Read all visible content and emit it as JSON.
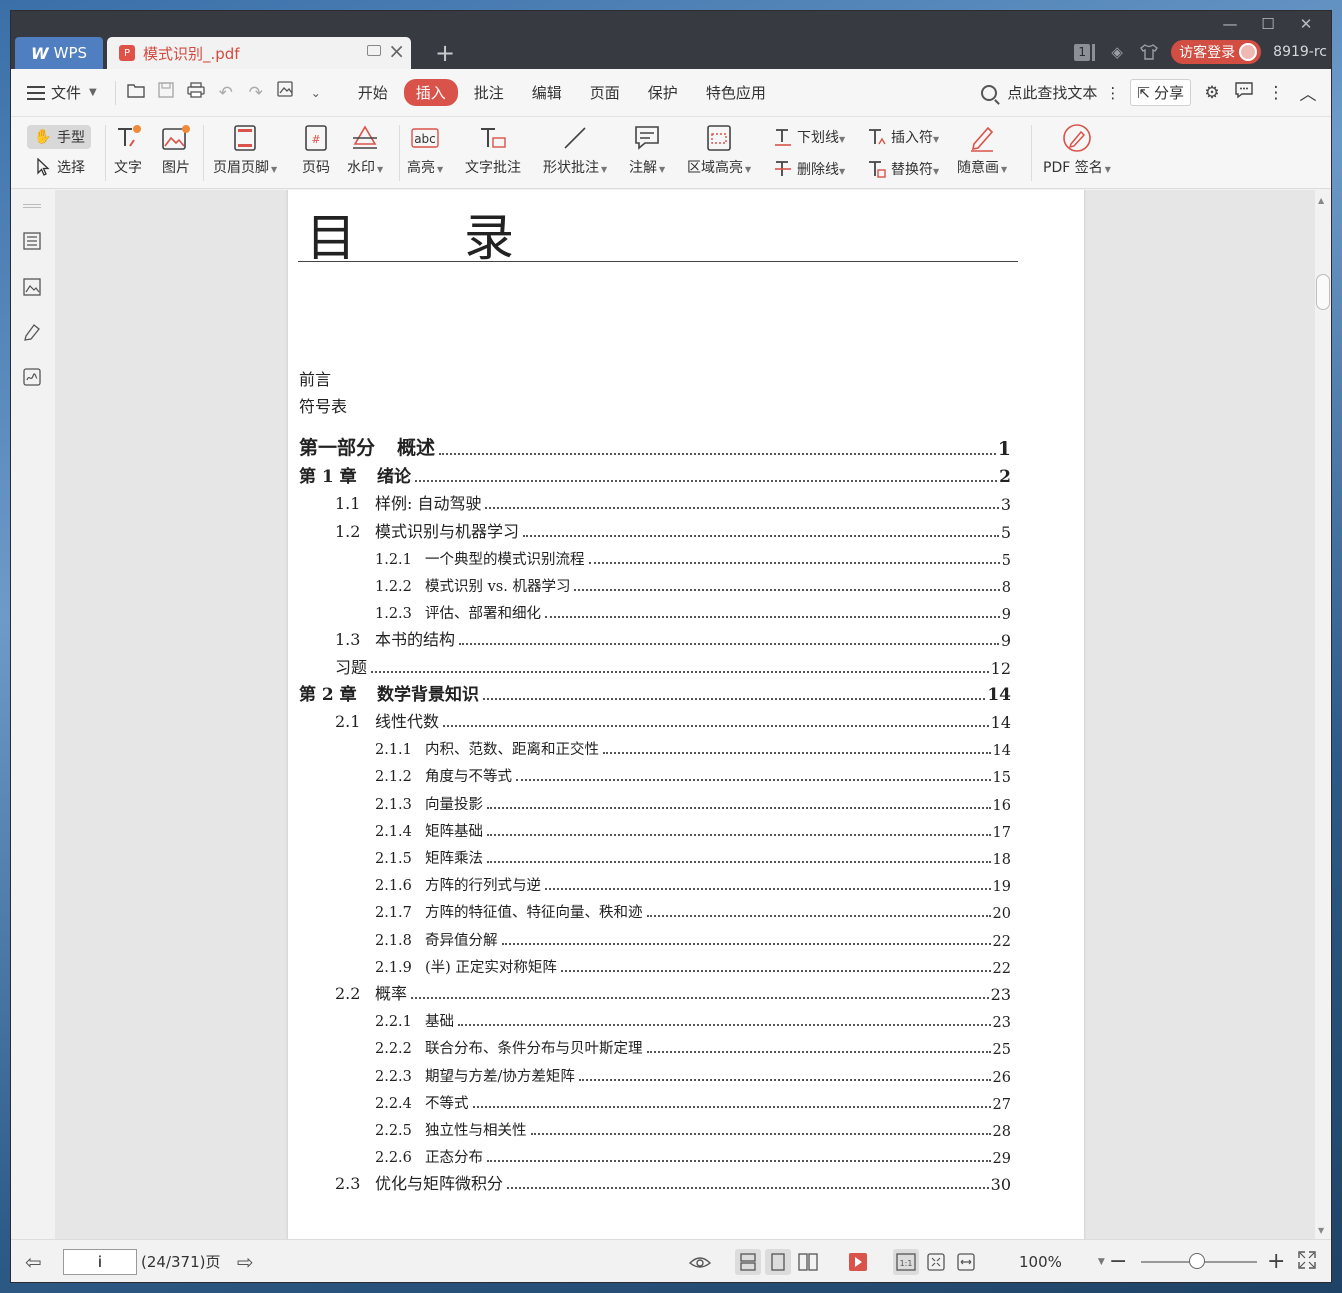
{
  "titlebar": {
    "wps_label": "WPS",
    "doc_tab_title": "模式识别_.pdf",
    "new_tab": "+",
    "tab_count": "1",
    "login_label": "访客登录",
    "user_name": "8919-rc"
  },
  "menubar": {
    "file_label": "文件",
    "tabs": [
      "开始",
      "插入",
      "批注",
      "编辑",
      "页面",
      "保护",
      "特色应用"
    ],
    "active_tab": "插入",
    "search_label": "点此查找文本",
    "share_label": "分享"
  },
  "ribbon": {
    "hand_label": "手型",
    "select_label": "选择",
    "text_label": "文字",
    "image_label": "图片",
    "header_footer_label": "页眉页脚",
    "page_number_label": "页码",
    "watermark_label": "水印",
    "highlight_label": "高亮",
    "text_comment_label": "文字批注",
    "shape_comment_label": "形状批注",
    "note_label": "注解",
    "area_highlight_label": "区域高亮",
    "underline_label": "下划线",
    "strikethrough_label": "删除线",
    "insert_mark_label": "插入符",
    "replace_mark_label": "替换符",
    "freehand_label": "随意画",
    "pdf_sign_label": "PDF 签名"
  },
  "document": {
    "toc_title_1": "目",
    "toc_title_2": "录",
    "preface": "前言",
    "symbols": "符号表",
    "toc": [
      {
        "level": "part",
        "num": "第一部分",
        "title": "概述",
        "page": "1"
      },
      {
        "level": "ch",
        "num": "第 1 章",
        "title": "绪论",
        "page": "2"
      },
      {
        "level": "sec",
        "num": "1.1",
        "title": "样例: 自动驾驶",
        "page": "3"
      },
      {
        "level": "sec",
        "num": "1.2",
        "title": "模式识别与机器学习",
        "page": "5"
      },
      {
        "level": "sub",
        "num": "1.2.1",
        "title": "一个典型的模式识别流程",
        "page": "5"
      },
      {
        "level": "sub",
        "num": "1.2.2",
        "title": "模式识别 vs. 机器学习",
        "page": "8"
      },
      {
        "level": "sub",
        "num": "1.2.3",
        "title": "评估、部署和细化",
        "page": "9"
      },
      {
        "level": "sec",
        "num": "1.3",
        "title": "本书的结构",
        "page": "9"
      },
      {
        "level": "sec",
        "num": "",
        "title": "习题",
        "page": "12"
      },
      {
        "level": "ch",
        "num": "第 2 章",
        "title": "数学背景知识",
        "page": "14"
      },
      {
        "level": "sec",
        "num": "2.1",
        "title": "线性代数",
        "page": "14"
      },
      {
        "level": "sub",
        "num": "2.1.1",
        "title": "内积、范数、距离和正交性",
        "page": "14"
      },
      {
        "level": "sub",
        "num": "2.1.2",
        "title": "角度与不等式",
        "page": "15"
      },
      {
        "level": "sub",
        "num": "2.1.3",
        "title": "向量投影",
        "page": "16"
      },
      {
        "level": "sub",
        "num": "2.1.4",
        "title": "矩阵基础",
        "page": "17"
      },
      {
        "level": "sub",
        "num": "2.1.5",
        "title": "矩阵乘法",
        "page": "18"
      },
      {
        "level": "sub",
        "num": "2.1.6",
        "title": "方阵的行列式与逆",
        "page": "19"
      },
      {
        "level": "sub",
        "num": "2.1.7",
        "title": "方阵的特征值、特征向量、秩和迹",
        "page": "20"
      },
      {
        "level": "sub",
        "num": "2.1.8",
        "title": "奇异值分解",
        "page": "22"
      },
      {
        "level": "sub",
        "num": "2.1.9",
        "title": "(半) 正定实对称矩阵",
        "page": "22"
      },
      {
        "level": "sec",
        "num": "2.2",
        "title": "概率",
        "page": "23"
      },
      {
        "level": "sub",
        "num": "2.2.1",
        "title": "基础",
        "page": "23"
      },
      {
        "level": "sub",
        "num": "2.2.2",
        "title": "联合分布、条件分布与贝叶斯定理",
        "page": "25"
      },
      {
        "level": "sub",
        "num": "2.2.3",
        "title": "期望与方差/协方差矩阵",
        "page": "26"
      },
      {
        "level": "sub",
        "num": "2.2.4",
        "title": "不等式",
        "page": "27"
      },
      {
        "level": "sub",
        "num": "2.2.5",
        "title": "独立性与相关性",
        "page": "28"
      },
      {
        "level": "sub",
        "num": "2.2.6",
        "title": "正态分布",
        "page": "29"
      },
      {
        "level": "sec",
        "num": "2.3",
        "title": "优化与矩阵微积分",
        "page": "30"
      }
    ]
  },
  "statusbar": {
    "page_value": "i",
    "page_info": "(24/371)",
    "page_unit": "页",
    "zoom": "100%",
    "zoom_fraction": 0.48
  }
}
